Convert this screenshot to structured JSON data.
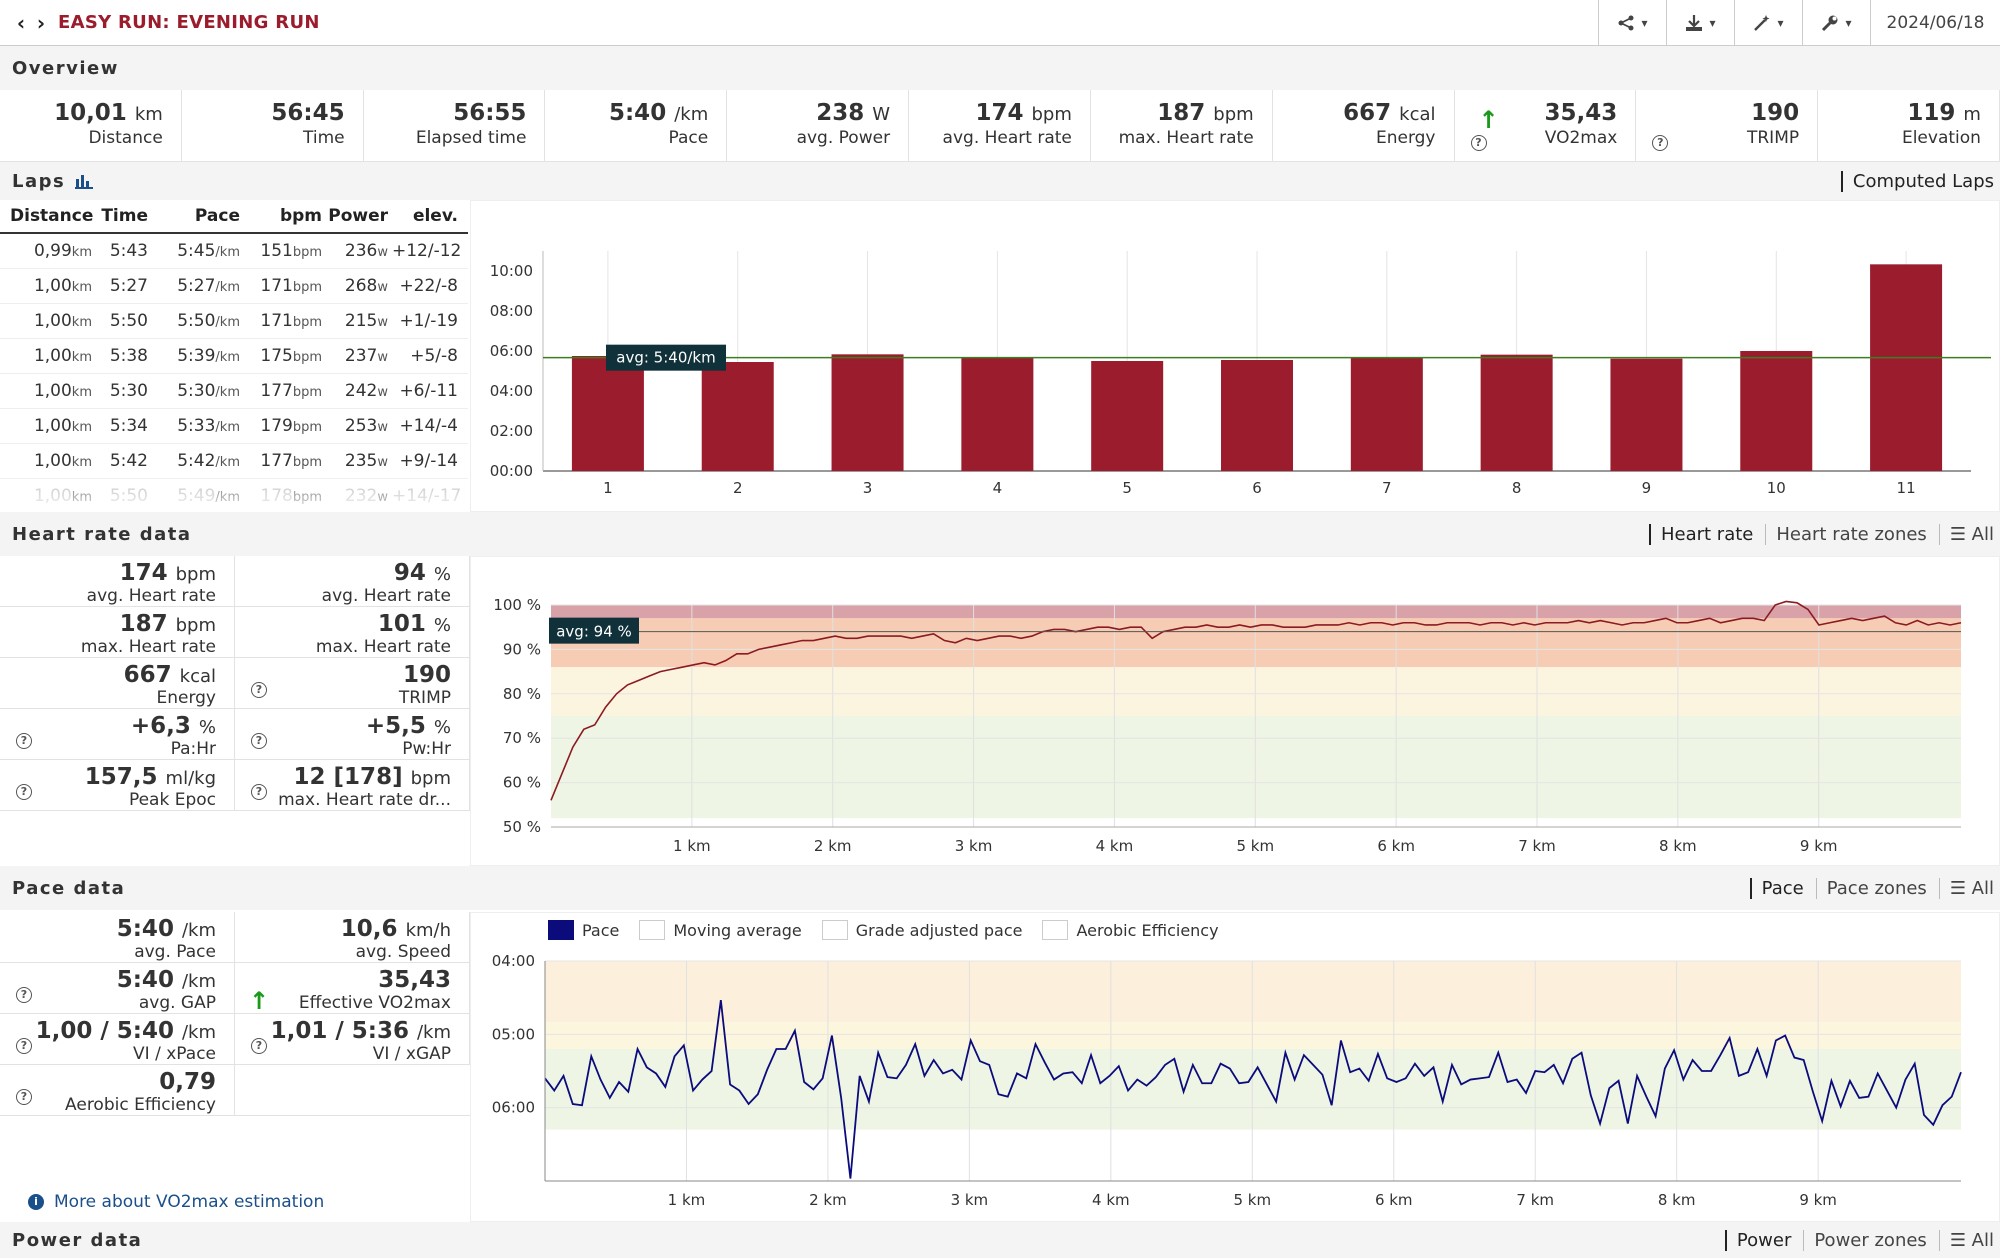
{
  "header": {
    "title": "EASY RUN: EVENING RUN",
    "date": "2024/06/18"
  },
  "overview": {
    "heading": "Overview",
    "cells": [
      {
        "value": "10,01",
        "unit": "km",
        "label": "Distance"
      },
      {
        "value": "56:45",
        "unit": "",
        "label": "Time"
      },
      {
        "value": "56:55",
        "unit": "",
        "label": "Elapsed time"
      },
      {
        "value": "5:40",
        "unit": "/km",
        "label": "Pace"
      },
      {
        "value": "238",
        "unit": "W",
        "label": "avg. Power"
      },
      {
        "value": "174",
        "unit": "bpm",
        "label": "avg. Heart rate"
      },
      {
        "value": "187",
        "unit": "bpm",
        "label": "max. Heart rate"
      },
      {
        "value": "667",
        "unit": "kcal",
        "label": "Energy"
      },
      {
        "value": "35,43",
        "unit": "",
        "label": "VO2max"
      },
      {
        "value": "190",
        "unit": "",
        "label": "TRIMP"
      },
      {
        "value": "119",
        "unit": "m",
        "label": "Elevation"
      }
    ]
  },
  "laps": {
    "heading": "Laps",
    "mode": "Computed Laps",
    "columns": [
      "Distance",
      "Time",
      "Pace",
      "bpm",
      "Power",
      "elev."
    ],
    "rows": [
      {
        "dist": "0,99",
        "time": "5:43",
        "pace": "5:45",
        "bpm": "151",
        "power": "236",
        "elev": "+12/-12"
      },
      {
        "dist": "1,00",
        "time": "5:27",
        "pace": "5:27",
        "bpm": "171",
        "power": "268",
        "elev": "+22/-8"
      },
      {
        "dist": "1,00",
        "time": "5:50",
        "pace": "5:50",
        "bpm": "171",
        "power": "215",
        "elev": "+1/-19"
      },
      {
        "dist": "1,00",
        "time": "5:38",
        "pace": "5:39",
        "bpm": "175",
        "power": "237",
        "elev": "+5/-8"
      },
      {
        "dist": "1,00",
        "time": "5:30",
        "pace": "5:30",
        "bpm": "177",
        "power": "242",
        "elev": "+6/-11"
      },
      {
        "dist": "1,00",
        "time": "5:34",
        "pace": "5:33",
        "bpm": "179",
        "power": "253",
        "elev": "+14/-4"
      },
      {
        "dist": "1,00",
        "time": "5:42",
        "pace": "5:42",
        "bpm": "177",
        "power": "235",
        "elev": "+9/-14"
      },
      {
        "dist": "1,00",
        "time": "5:50",
        "pace": "5:49",
        "bpm": "178",
        "power": "232",
        "elev": "+14/-17"
      }
    ],
    "units": {
      "km": "km",
      "pace": "/km",
      "bpm": "bpm",
      "w": "w"
    }
  },
  "hr": {
    "heading": "Heart rate data",
    "tabs": [
      "Heart rate",
      "Heart rate zones",
      "All"
    ],
    "stats": [
      [
        {
          "value": "174",
          "unit": "bpm",
          "label": "avg. Heart rate"
        },
        {
          "value": "94",
          "unit": "%",
          "label": "avg. Heart rate"
        }
      ],
      [
        {
          "value": "187",
          "unit": "bpm",
          "label": "max. Heart rate"
        },
        {
          "value": "101",
          "unit": "%",
          "label": "max. Heart rate"
        }
      ],
      [
        {
          "value": "667",
          "unit": "kcal",
          "label": "Energy"
        },
        {
          "value": "190",
          "unit": "",
          "label": "TRIMP"
        }
      ],
      [
        {
          "value": "+6,3",
          "unit": "%",
          "label": "Pa:Hr"
        },
        {
          "value": "+5,5",
          "unit": "%",
          "label": "Pw:Hr"
        }
      ],
      [
        {
          "value": "157,5",
          "unit": "ml/kg",
          "label": "Peak Epoc"
        },
        {
          "value": "12 [178]",
          "unit": "bpm",
          "label": "max. Heart rate dr..."
        }
      ]
    ]
  },
  "pace": {
    "heading": "Pace data",
    "tabs": [
      "Pace",
      "Pace zones",
      "All"
    ],
    "legend": [
      "Pace",
      "Moving average",
      "Grade adjusted pace",
      "Aerobic Efficiency"
    ],
    "stats": [
      [
        {
          "value": "5:40",
          "unit": "/km",
          "label": "avg. Pace"
        },
        {
          "value": "10,6",
          "unit": "km/h",
          "label": "avg. Speed"
        }
      ],
      [
        {
          "value": "5:40",
          "unit": "/km",
          "label": "avg. GAP"
        },
        {
          "value": "35,43",
          "unit": "",
          "label": "Effective VO2max"
        }
      ],
      [
        {
          "value": "1,00 / 5:40",
          "unit": "/km",
          "label": "VI / xPace"
        },
        {
          "value": "1,01 / 5:36",
          "unit": "/km",
          "label": "VI / xGAP"
        }
      ],
      [
        {
          "value": "0,79",
          "unit": "",
          "label": "Aerobic Efficiency"
        }
      ]
    ],
    "more_link": "More about VO2max estimation"
  },
  "power": {
    "heading": "Power data",
    "tabs": [
      "Power",
      "Power zones",
      "All"
    ]
  },
  "chart_data": [
    {
      "type": "bar",
      "title": "",
      "categories": [
        "1",
        "2",
        "3",
        "4",
        "5",
        "6",
        "7",
        "8",
        "9",
        "10",
        "11"
      ],
      "values_seconds": [
        345,
        327,
        350,
        339,
        330,
        333,
        342,
        349,
        337,
        360,
        620
      ],
      "y_ticks": [
        "00:00",
        "02:00",
        "04:00",
        "06:00",
        "08:00",
        "10:00"
      ],
      "ylim_seconds": [
        0,
        660
      ],
      "reference_line": {
        "value_seconds": 340,
        "label": "avg: 5:40/km"
      },
      "color": "#9b1c2c"
    },
    {
      "type": "line",
      "title": "",
      "x_ticks": [
        "1 km",
        "2 km",
        "3 km",
        "4 km",
        "5 km",
        "6 km",
        "7 km",
        "8 km",
        "9 km"
      ],
      "xlim_km": [
        0,
        10.01
      ],
      "y_ticks": [
        "50 %",
        "60 %",
        "70 %",
        "80 %",
        "90 %",
        "100 %"
      ],
      "ylim": [
        50,
        100
      ],
      "reference_line": {
        "value": 94,
        "label": "avg: 94 %"
      },
      "series": [
        {
          "values": [
            56,
            62,
            68,
            72,
            73,
            77,
            80,
            82,
            83,
            84,
            85,
            85.5,
            86,
            86.5,
            87,
            86.5,
            87.5,
            89,
            89,
            90,
            90.5,
            91,
            91.5,
            92,
            92,
            92.5,
            93,
            92.5,
            92.5,
            93,
            93,
            93,
            93,
            92.5,
            93,
            93.5,
            92,
            91.5,
            92.5,
            92,
            92.5,
            93,
            93,
            92.5,
            93,
            94,
            94.5,
            94.5,
            94,
            94.5,
            95,
            95,
            94.5,
            95,
            95,
            92.5,
            94,
            94.5,
            95,
            95,
            95.5,
            95,
            95,
            95.5,
            95,
            95.5,
            95.5,
            95,
            95,
            95,
            95.5,
            95.5,
            95.5,
            96,
            95.5,
            96,
            96,
            95.5,
            96,
            96,
            95.5,
            95.5,
            96,
            96,
            96,
            95.5,
            96,
            96,
            95.5,
            96,
            95.5,
            96,
            96,
            96,
            96.5,
            96,
            96.5,
            96,
            95.5,
            96,
            96,
            96.5,
            97,
            96,
            96,
            96.5,
            97,
            96,
            96.5,
            97,
            97,
            96.5,
            100,
            101,
            100.5,
            99,
            95.5,
            96,
            96.5,
            97,
            96.5,
            97,
            97.5,
            96,
            95.5,
            96.5,
            95.5,
            96,
            95.5,
            96
          ]
        }
      ],
      "color": "#8b1a22"
    },
    {
      "type": "line",
      "title": "",
      "x_ticks": [
        "1 km",
        "2 km",
        "3 km",
        "4 km",
        "5 km",
        "6 km",
        "7 km",
        "8 km",
        "9 km"
      ],
      "xlim_km": [
        0,
        10.01
      ],
      "y_ticks": [
        "04:00",
        "05:00",
        "06:00"
      ],
      "ylim_seconds": [
        240,
        420
      ],
      "series": [
        {
          "name": "Pace",
          "values_seconds": [
            336,
            346,
            334,
            357,
            358,
            318,
            337,
            352,
            339,
            347,
            312,
            327,
            332,
            343,
            318,
            309,
            346,
            337,
            330,
            272,
            341,
            346,
            357,
            349,
            329,
            312,
            312,
            297,
            339,
            345,
            336,
            301,
            352,
            418,
            334,
            355,
            315,
            335,
            336,
            325,
            308,
            334,
            321,
            332,
            329,
            337,
            305,
            322,
            325,
            349,
            351,
            332,
            336,
            308,
            323,
            337,
            332,
            331,
            340,
            317,
            340,
            334,
            326,
            346,
            337,
            342,
            335,
            325,
            320,
            347,
            325,
            340,
            340,
            324,
            328,
            340,
            339,
            327,
            341,
            355,
            315,
            337,
            317,
            325,
            333,
            358,
            305,
            331,
            328,
            338,
            316,
            336,
            339,
            336,
            324,
            334,
            327,
            355,
            325,
            341,
            337,
            336,
            335,
            315,
            339,
            337,
            348,
            330,
            331,
            325,
            340,
            320,
            315,
            350,
            373,
            344,
            338,
            373,
            334,
            351,
            367,
            328,
            313,
            337,
            321,
            330,
            330,
            317,
            303,
            334,
            331,
            312,
            334,
            305,
            301,
            319,
            321,
            347,
            371,
            338,
            359,
            338,
            352,
            351,
            332,
            346,
            360,
            337,
            324,
            366,
            374,
            358,
            351,
            331
          ]
        }
      ],
      "color": "#0b0b7c"
    }
  ]
}
